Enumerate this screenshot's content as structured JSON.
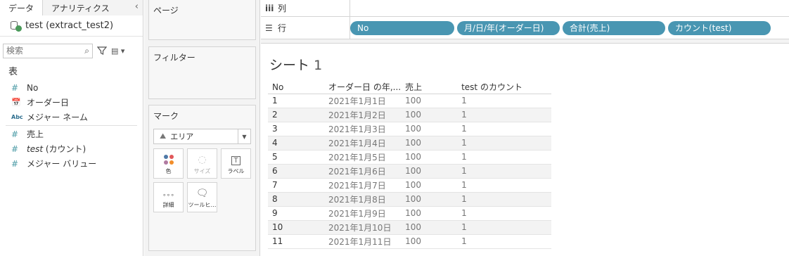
{
  "left": {
    "tabs": [
      "データ",
      "アナリティクス"
    ],
    "collapse_icon": "chevron-left-icon",
    "datasource": "test (extract_test2)",
    "search_placeholder": "検索",
    "section_title": "表",
    "fields": [
      {
        "icon": "#",
        "name": "No"
      },
      {
        "icon": "cal",
        "name": "オーダー日"
      },
      {
        "icon": "Abc",
        "name": "メジャー ネーム"
      },
      {
        "icon": "#",
        "name": "売上"
      },
      {
        "icon": "#",
        "name_italic": "test",
        "name_rest": " (カウント)"
      },
      {
        "icon": "#",
        "name": "メジャー バリュー"
      }
    ]
  },
  "shelves": {
    "page_title": "ページ",
    "filter_title": "フィルター",
    "marks_title": "マーク",
    "mark_type": "エリア",
    "mark_buttons": [
      "色",
      "サイズ",
      "ラベル",
      "詳細",
      "ツールヒ…"
    ]
  },
  "main": {
    "columns_label": "列",
    "rows_label": "行",
    "row_pills": [
      "No",
      "月/日/年(オーダー日)",
      "合計(売上)",
      "カウント(test)"
    ],
    "sheet_title": "シート",
    "sheet_number": "1",
    "table": {
      "headers": [
        "No",
        "オーダー日 の年,...",
        "売上",
        "test のカウント"
      ],
      "rows": [
        [
          "1",
          "2021年1月1日",
          "100",
          "1"
        ],
        [
          "2",
          "2021年1月2日",
          "100",
          "1"
        ],
        [
          "3",
          "2021年1月3日",
          "100",
          "1"
        ],
        [
          "4",
          "2021年1月4日",
          "100",
          "1"
        ],
        [
          "5",
          "2021年1月5日",
          "100",
          "1"
        ],
        [
          "6",
          "2021年1月6日",
          "100",
          "1"
        ],
        [
          "7",
          "2021年1月7日",
          "100",
          "1"
        ],
        [
          "8",
          "2021年1月8日",
          "100",
          "1"
        ],
        [
          "9",
          "2021年1月9日",
          "100",
          "1"
        ],
        [
          "10",
          "2021年1月10日",
          "100",
          "1"
        ],
        [
          "11",
          "2021年1月11日",
          "100",
          "1"
        ]
      ]
    }
  },
  "colors": {
    "pill": "#4996b2",
    "accent_green": "#4a9a5a"
  }
}
